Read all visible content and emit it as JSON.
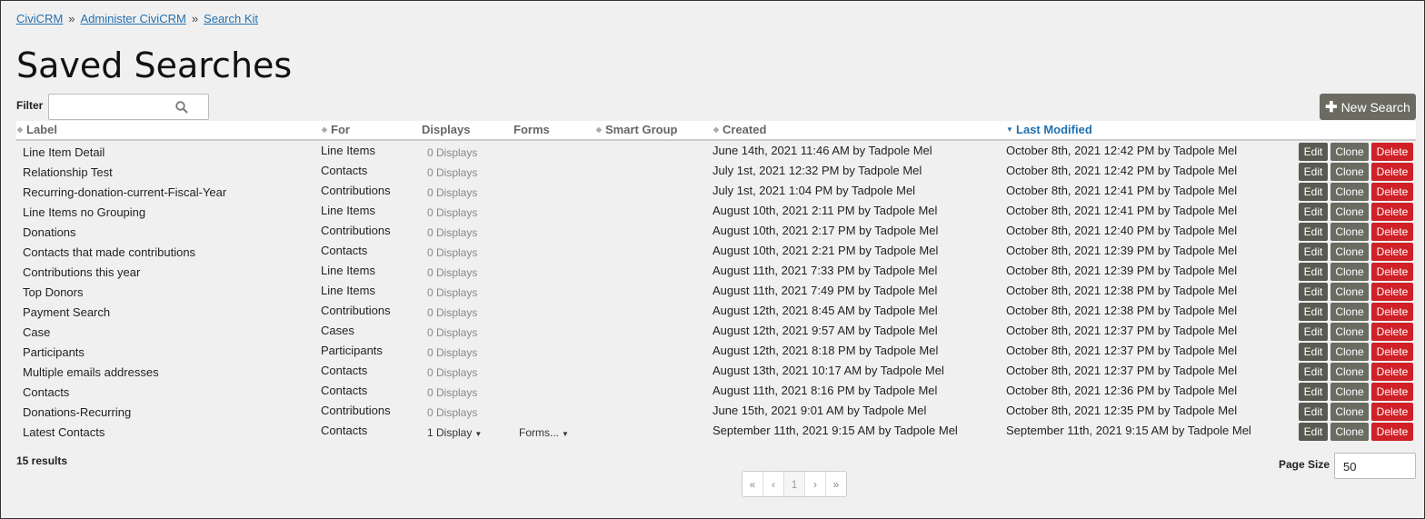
{
  "breadcrumb": {
    "items": [
      "CiviCRM",
      "Administer CiviCRM",
      "Search Kit"
    ],
    "separator": "»"
  },
  "page_title": "Saved Searches",
  "filter": {
    "label": "Filter",
    "value": ""
  },
  "new_search_label": "New Search",
  "columns": {
    "label": "Label",
    "for": "For",
    "displays": "Displays",
    "forms": "Forms",
    "smart_group": "Smart Group",
    "created": "Created",
    "last_modified": "Last Modified"
  },
  "buttons": {
    "edit": "Edit",
    "clone": "Clone",
    "delete": "Delete"
  },
  "rows": [
    {
      "label": "Line Item Detail",
      "for": "Line Items",
      "displays": "0 Displays",
      "forms": "",
      "created": "June 14th, 2021 11:46 AM by Tadpole Mel",
      "modified": "October 8th, 2021 12:42 PM by Tadpole Mel"
    },
    {
      "label": "Relationship Test",
      "for": "Contacts",
      "displays": "0 Displays",
      "forms": "",
      "created": "July 1st, 2021 12:32 PM by Tadpole Mel",
      "modified": "October 8th, 2021 12:42 PM by Tadpole Mel"
    },
    {
      "label": "Recurring-donation-current-Fiscal-Year",
      "for": "Contributions",
      "displays": "0 Displays",
      "forms": "",
      "created": "July 1st, 2021 1:04 PM by Tadpole Mel",
      "modified": "October 8th, 2021 12:41 PM by Tadpole Mel"
    },
    {
      "label": "Line Items no Grouping",
      "for": "Line Items",
      "displays": "0 Displays",
      "forms": "",
      "created": "August 10th, 2021 2:11 PM by Tadpole Mel",
      "modified": "October 8th, 2021 12:41 PM by Tadpole Mel"
    },
    {
      "label": "Donations",
      "for": "Contributions",
      "displays": "0 Displays",
      "forms": "",
      "created": "August 10th, 2021 2:17 PM by Tadpole Mel",
      "modified": "October 8th, 2021 12:40 PM by Tadpole Mel"
    },
    {
      "label": "Contacts that made contributions",
      "for": "Contacts",
      "displays": "0 Displays",
      "forms": "",
      "created": "August 10th, 2021 2:21 PM by Tadpole Mel",
      "modified": "October 8th, 2021 12:39 PM by Tadpole Mel"
    },
    {
      "label": "Contributions this year",
      "for": "Line Items",
      "displays": "0 Displays",
      "forms": "",
      "created": "August 11th, 2021 7:33 PM by Tadpole Mel",
      "modified": "October 8th, 2021 12:39 PM by Tadpole Mel"
    },
    {
      "label": "Top Donors",
      "for": "Line Items",
      "displays": "0 Displays",
      "forms": "",
      "created": "August 11th, 2021 7:49 PM by Tadpole Mel",
      "modified": "October 8th, 2021 12:38 PM by Tadpole Mel"
    },
    {
      "label": "Payment Search",
      "for": "Contributions",
      "displays": "0 Displays",
      "forms": "",
      "created": "August 12th, 2021 8:45 AM by Tadpole Mel",
      "modified": "October 8th, 2021 12:38 PM by Tadpole Mel"
    },
    {
      "label": "Case",
      "for": "Cases",
      "displays": "0 Displays",
      "forms": "",
      "created": "August 12th, 2021 9:57 AM by Tadpole Mel",
      "modified": "October 8th, 2021 12:37 PM by Tadpole Mel"
    },
    {
      "label": "Participants",
      "for": "Participants",
      "displays": "0 Displays",
      "forms": "",
      "created": "August 12th, 2021 8:18 PM by Tadpole Mel",
      "modified": "October 8th, 2021 12:37 PM by Tadpole Mel"
    },
    {
      "label": "Multiple emails addresses",
      "for": "Contacts",
      "displays": "0 Displays",
      "forms": "",
      "created": "August 13th, 2021 10:17 AM by Tadpole Mel",
      "modified": "October 8th, 2021 12:37 PM by Tadpole Mel"
    },
    {
      "label": "Contacts",
      "for": "Contacts",
      "displays": "0 Displays",
      "forms": "",
      "created": "August 11th, 2021 8:16 PM by Tadpole Mel",
      "modified": "October 8th, 2021 12:36 PM by Tadpole Mel"
    },
    {
      "label": "Donations-Recurring",
      "for": "Contributions",
      "displays": "0 Displays",
      "forms": "",
      "created": "June 15th, 2021 9:01 AM by Tadpole Mel",
      "modified": "October 8th, 2021 12:35 PM by Tadpole Mel"
    },
    {
      "label": "Latest Contacts",
      "for": "Contacts",
      "displays": "1 Display",
      "forms": "Forms...",
      "created": "September 11th, 2021 9:15 AM by Tadpole Mel",
      "modified": "September 11th, 2021 9:15 AM by Tadpole Mel"
    }
  ],
  "results_text": "15 results",
  "pager": {
    "first": "«",
    "prev": "‹",
    "current": "1",
    "next": "›",
    "last": "»"
  },
  "page_size": {
    "label": "Page Size",
    "value": "50"
  }
}
